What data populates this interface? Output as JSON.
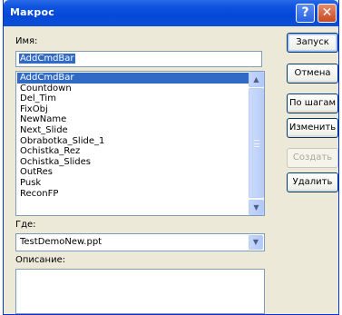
{
  "window": {
    "title": "Макрос"
  },
  "title_buttons": {
    "help": "?",
    "close": "✕"
  },
  "name_section": {
    "label": "Имя:",
    "value": "AddCmdBar"
  },
  "macro_list": {
    "items": [
      "AddCmdBar",
      "Countdown",
      "Del_Tim",
      "FixObj",
      "NewName",
      "Next_Slide",
      "Obrabotka_Slide_1",
      "Ochistka_Rez",
      "Ochistka_Slides",
      "OutRes",
      "Pusk",
      "ReconFP"
    ],
    "selected_index": 0
  },
  "where_section": {
    "label": "Где:",
    "value": "TestDemoNew.ppt"
  },
  "description_section": {
    "label": "Описание:",
    "value": ""
  },
  "buttons": {
    "run": "Запуск",
    "cancel": "Отмена",
    "step_into": "По шагам",
    "edit": "Изменить",
    "create": "Создать",
    "delete": "Удалить"
  },
  "scroll": {
    "up_arrow": "▲",
    "down_arrow": "▼"
  },
  "colors": {
    "titlebar": "#0548d8",
    "selection": "#316ac5",
    "face": "#ece9d8"
  }
}
